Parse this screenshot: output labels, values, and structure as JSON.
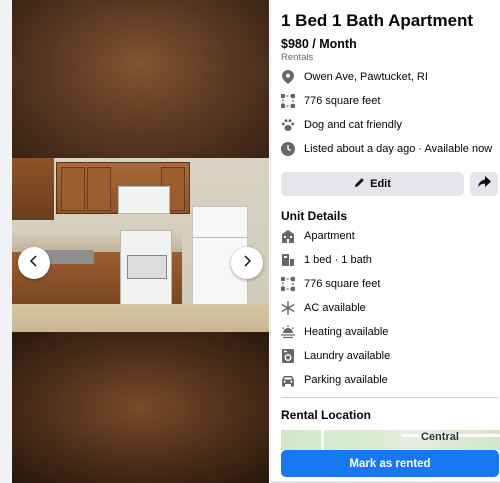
{
  "listing": {
    "title": "1 Bed 1 Bath Apartment",
    "price": "$980 / Month",
    "category": "Rentals"
  },
  "details": [
    {
      "icon": "location-pin-icon",
      "text": "Owen Ave, Pawtucket, RI"
    },
    {
      "icon": "square-footage-icon",
      "text": "776 square feet"
    },
    {
      "icon": "paw-icon",
      "text": "Dog and cat friendly"
    },
    {
      "icon": "clock-icon",
      "text": "Listed about a day ago · Available now"
    }
  ],
  "actions": {
    "edit_label": "Edit",
    "mark_rented_label": "Mark as rented"
  },
  "unit_details": {
    "title": "Unit Details",
    "items": [
      {
        "icon": "building-icon",
        "text": "Apartment"
      },
      {
        "icon": "bed-icon",
        "text": "1 bed · 1 bath"
      },
      {
        "icon": "square-footage-icon",
        "text": "776 square feet"
      },
      {
        "icon": "snowflake-icon",
        "text": "AC available"
      },
      {
        "icon": "heating-icon",
        "text": "Heating available"
      },
      {
        "icon": "washer-icon",
        "text": "Laundry available"
      },
      {
        "icon": "car-icon",
        "text": "Parking available"
      }
    ]
  },
  "rental_location": {
    "title": "Rental Location",
    "map_label": "Central"
  },
  "colors": {
    "accent": "#1877f2",
    "button_gray": "#e4e6eb",
    "icon_gray": "#65676b"
  }
}
